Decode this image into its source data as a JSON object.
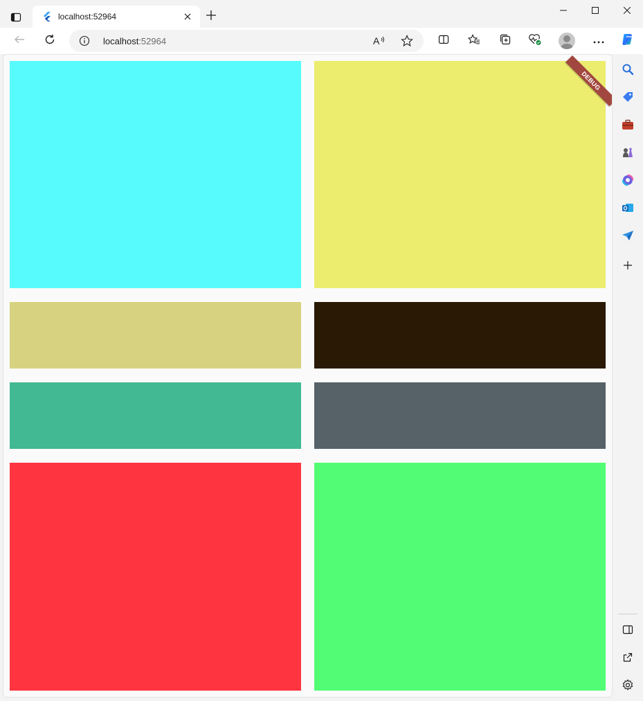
{
  "browser": {
    "tab_title": "localhost:52964",
    "url_host": "localhost",
    "url_port": ":52964"
  },
  "app": {
    "debug_banner": "DEBUG",
    "tiles": [
      {
        "name": "cyan-tile",
        "color": "#57fbfd"
      },
      {
        "name": "yellow-tile",
        "color": "#ecec6e"
      },
      {
        "name": "khaki-tile",
        "color": "#d7d27f"
      },
      {
        "name": "dark-brown-tile",
        "color": "#291905"
      },
      {
        "name": "teal-tile",
        "color": "#42b893"
      },
      {
        "name": "slate-tile",
        "color": "#566168"
      },
      {
        "name": "red-tile",
        "color": "#fe3440"
      },
      {
        "name": "green-tile",
        "color": "#52fd75"
      }
    ]
  },
  "icons": {
    "tab_actions": "tab-actions-icon",
    "favicon": "flutter-icon",
    "close": "close-icon",
    "new_tab": "plus-icon",
    "minimize": "minimize-icon",
    "maximize": "maximize-icon",
    "window_close": "close-icon",
    "back": "back-arrow-icon",
    "refresh": "refresh-icon",
    "site_info": "info-icon",
    "read_aloud": "read-aloud-icon",
    "favorite": "star-icon",
    "split_screen": "split-screen-icon",
    "favorites": "favorites-icon",
    "collections": "collections-icon",
    "browser_essentials": "heart-pulse-icon",
    "profile": "profile-icon",
    "more": "more-icon",
    "copilot": "copilot-icon"
  }
}
